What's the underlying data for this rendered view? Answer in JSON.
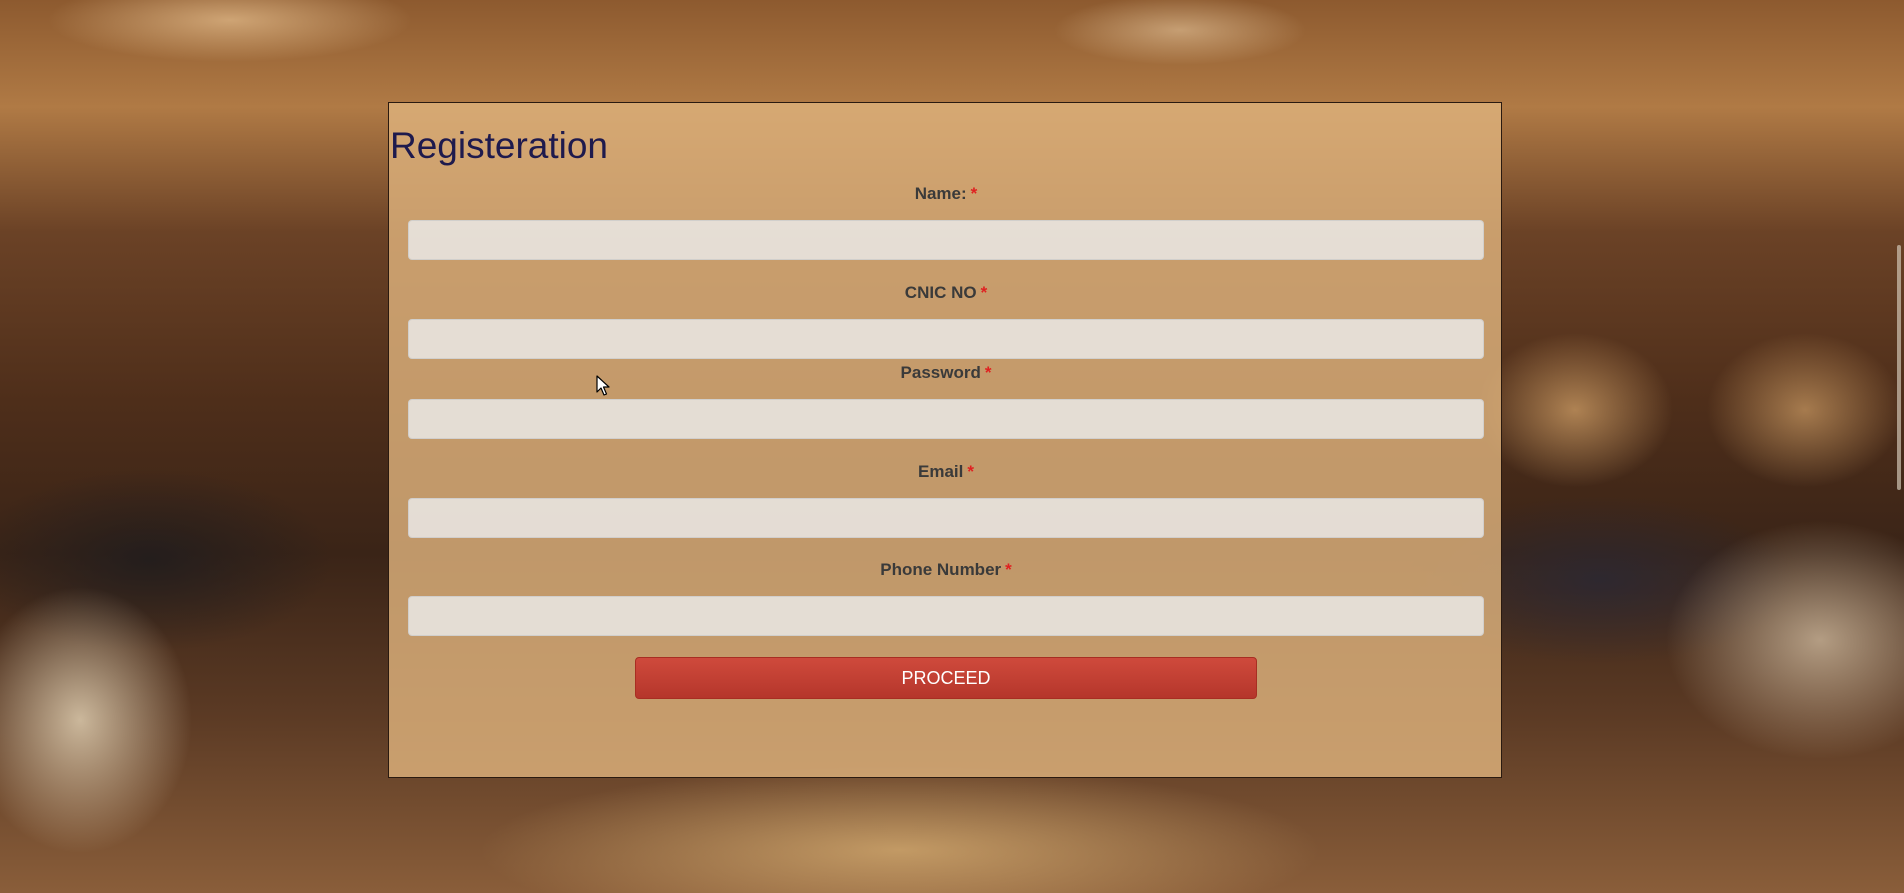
{
  "form": {
    "title": "Registeration",
    "fields": [
      {
        "label": "Name:",
        "required_mark": "*",
        "value": "",
        "placeholder": ""
      },
      {
        "label": "CNIC NO",
        "required_mark": "*",
        "value": "",
        "placeholder": ""
      },
      {
        "label": "Password",
        "required_mark": "*",
        "value": "",
        "placeholder": ""
      },
      {
        "label": "Email",
        "required_mark": "*",
        "value": "",
        "placeholder": ""
      },
      {
        "label": "Phone Number",
        "required_mark": "*",
        "value": "",
        "placeholder": ""
      }
    ],
    "submit_label": "PROCEED"
  },
  "colors": {
    "title": "#1e1a4d",
    "required": "#e02020",
    "button": "#c0392b",
    "panel": "#deb27d"
  }
}
